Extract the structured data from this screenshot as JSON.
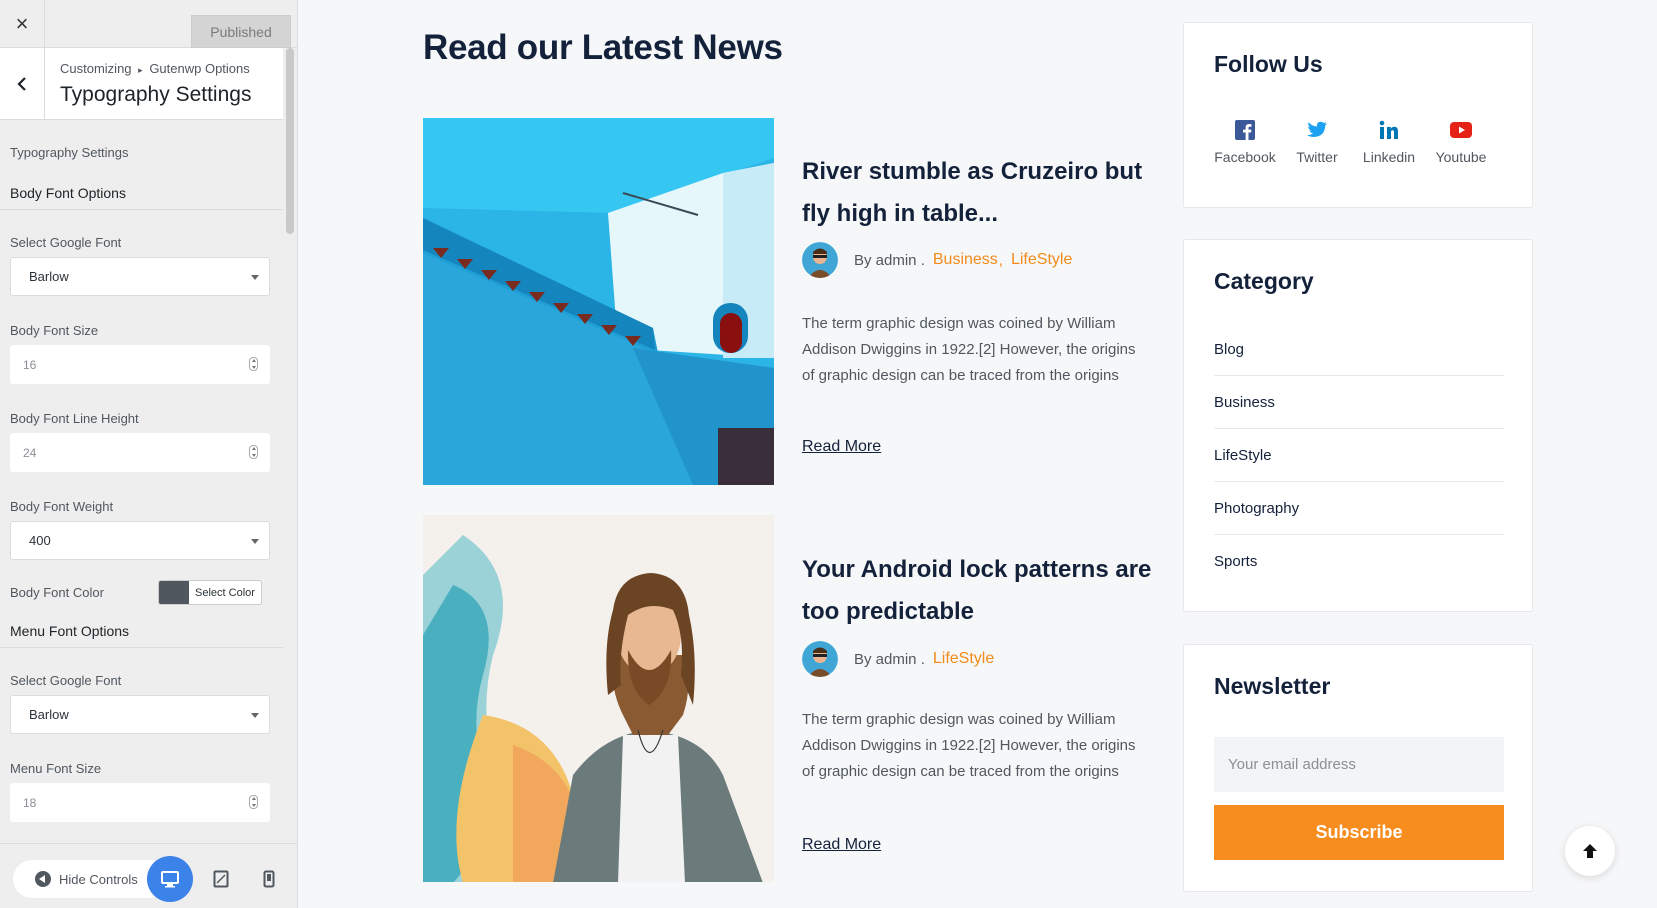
{
  "customizer": {
    "close_label": "×",
    "publish_label": "Published",
    "breadcrumb": {
      "root": "Customizing",
      "separator": "▸",
      "section": "Gutenwp Options"
    },
    "panel_title": "Typography Settings",
    "section_description": "Typography Settings",
    "body_options": {
      "heading": "Body Font Options",
      "google_font_label": "Select Google Font",
      "google_font_value": "Barlow",
      "font_size_label": "Body Font Size",
      "font_size_value": "16",
      "line_height_label": "Body Font Line Height",
      "line_height_value": "24",
      "font_weight_label": "Body Font Weight",
      "font_weight_value": "400",
      "font_color_label": "Body Font Color",
      "select_color_label": "Select Color",
      "font_color_value": "#50575e"
    },
    "menu_options": {
      "heading": "Menu Font Options",
      "google_font_label": "Select Google Font",
      "google_font_value": "Barlow",
      "font_size_label": "Menu Font Size",
      "font_size_value": "18"
    },
    "footer": {
      "hide_controls_label": "Hide Controls",
      "devices": [
        "desktop-icon",
        "tablet-icon",
        "mobile-icon"
      ]
    }
  },
  "preview": {
    "section_title": "Read our Latest News",
    "posts": [
      {
        "title": "River stumble as Cruzeiro but fly high in table...",
        "author": "By admin .",
        "categories": [
          "Business",
          "LifeStyle"
        ],
        "excerpt": "The term graphic design was coined by William Addison Dwiggins in 1922.[2] However, the origins of graphic design can be traced from the origins",
        "read_more": "Read More"
      },
      {
        "title": "Your Android lock patterns are too predictable",
        "author": "By admin .",
        "categories": [
          "LifeStyle"
        ],
        "excerpt": "The term graphic design was coined by William Addison Dwiggins in 1922.[2] However, the origins of graphic design can be traced from the origins",
        "read_more": "Read More"
      }
    ],
    "follow": {
      "title": "Follow Us",
      "networks": [
        {
          "label": "Facebook",
          "icon": "facebook-icon",
          "color": "#3b5998"
        },
        {
          "label": "Twitter",
          "icon": "twitter-icon",
          "color": "#1da1f2"
        },
        {
          "label": "Linkedin",
          "icon": "linkedin-icon",
          "color": "#0077b5"
        },
        {
          "label": "Youtube",
          "icon": "youtube-icon",
          "color": "#e62117"
        }
      ]
    },
    "category": {
      "title": "Category",
      "items": [
        "Blog",
        "Business",
        "LifeStyle",
        "Photography",
        "Sports"
      ]
    },
    "newsletter": {
      "title": "Newsletter",
      "email_placeholder": "Your email address",
      "subscribe_label": "Subscribe"
    },
    "colors": {
      "accent": "#f78c1f",
      "heading": "#14213a",
      "text": "#50575e"
    }
  }
}
